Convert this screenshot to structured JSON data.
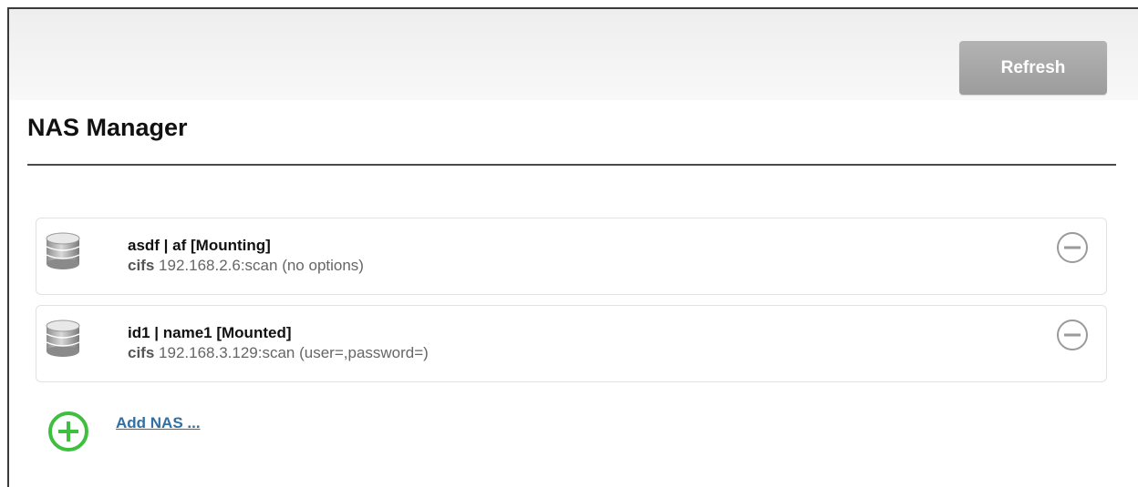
{
  "toolbar": {
    "refresh_label": "Refresh"
  },
  "page": {
    "title": "NAS Manager"
  },
  "nas_items": [
    {
      "title": "asdf | af [Mounting]",
      "fs_type": "cifs",
      "detail": "192.168.2.6:scan (no options)",
      "icon": "database-icon",
      "action_icon": "remove-icon"
    },
    {
      "title": "id1 | name1 [Mounted]",
      "fs_type": "cifs",
      "detail": "192.168.3.129:scan (user=,password=)",
      "icon": "database-icon",
      "action_icon": "remove-icon"
    }
  ],
  "add": {
    "label": "Add NAS ...",
    "icon": "add-icon"
  },
  "colors": {
    "accent_green": "#3fbf3f",
    "link_blue": "#2f6fa3",
    "button_gray": "#a6a6a6",
    "remove_gray": "#999999"
  }
}
